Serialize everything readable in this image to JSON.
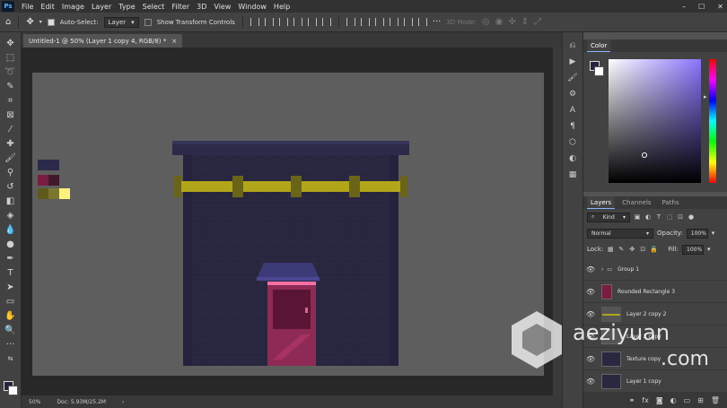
{
  "menubar": {
    "logo": "Ps",
    "items": [
      "File",
      "Edit",
      "Image",
      "Layer",
      "Type",
      "Select",
      "Filter",
      "3D",
      "View",
      "Window",
      "Help"
    ],
    "window_controls": [
      "–",
      "☐",
      "✕"
    ]
  },
  "options": {
    "auto_select_label": "Auto-Select:",
    "auto_select_value": "Layer",
    "show_transform_label": "Show Transform Controls",
    "mode_3d_label": "3D Mode:"
  },
  "document": {
    "tab_title": "Untitled-1 @ 50% (Layer 1 copy 4, RGB/8) *",
    "tab_close": "×"
  },
  "status": {
    "zoom": "50%",
    "doc_info": "Doc: 5.93M/25.2M",
    "arrow": "›"
  },
  "swatches": {
    "colors": [
      "#2c2a4a",
      "#7a1d40",
      "#5e5a1c",
      "#fff27a"
    ]
  },
  "color_panel": {
    "title": "Color",
    "fg_color": "#27233f",
    "bg_color": "#ffffff"
  },
  "layers_panel": {
    "tabs": [
      "Layers",
      "Channels",
      "Paths"
    ],
    "kind_label": "Kind",
    "blend_mode": "Normal",
    "opacity_label": "Opacity:",
    "opacity_value": "100%",
    "lock_label": "Lock:",
    "fill_label": "Fill:",
    "fill_value": "100%",
    "layers": [
      {
        "name": "Group 1",
        "type": "group"
      },
      {
        "name": "Rounded Rectangle 3",
        "type": "shape"
      },
      {
        "name": "Layer 2 copy 2",
        "type": "pixel"
      },
      {
        "name": "Layer 2 copy",
        "type": "pixel"
      },
      {
        "name": "Texture copy",
        "type": "pixel"
      },
      {
        "name": "Layer 1 copy",
        "type": "pixel"
      }
    ],
    "footer_icons": [
      "link-icon",
      "fx-icon",
      "mask-icon",
      "adjustment-icon",
      "folder-icon",
      "new-layer-icon",
      "trash-icon"
    ],
    "footer_glyphs": [
      "⚭",
      "fx",
      "◙",
      "◐",
      "▭",
      "⊞",
      "🗑"
    ]
  },
  "watermark": {
    "text_main": "aeziyuan",
    "text_sub": ".com"
  }
}
